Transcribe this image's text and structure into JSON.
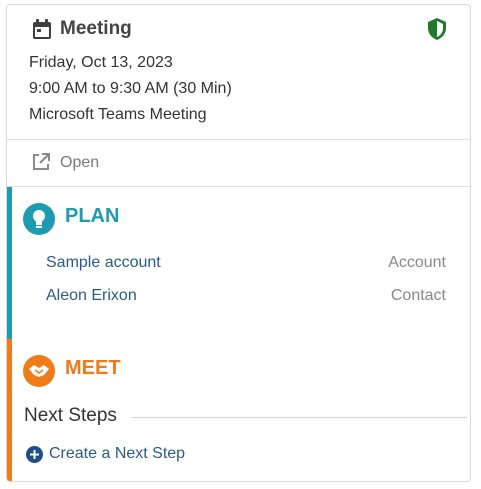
{
  "activity": {
    "title": "Meeting",
    "date": "Friday, Oct 13, 2023",
    "time": "9:00 AM to 9:30 AM (30 Min)",
    "location": "Microsoft Teams Meeting",
    "icons": {
      "type": "calendar-icon",
      "status": "shield-icon"
    }
  },
  "open": {
    "label": "Open",
    "icon": "external-link-icon"
  },
  "plan": {
    "title": "PLAN",
    "icon": "lightbulb-icon",
    "color": "#1e9bb0",
    "items": [
      {
        "name": "Sample account",
        "type": "Account"
      },
      {
        "name": "Aleon Erixon",
        "type": "Contact"
      }
    ]
  },
  "meet": {
    "title": "MEET",
    "icon": "handshake-icon",
    "color": "#f07b19",
    "next_steps": {
      "title": "Next Steps",
      "create_label": "Create a Next Step",
      "icon": "plus-circle-icon"
    }
  }
}
